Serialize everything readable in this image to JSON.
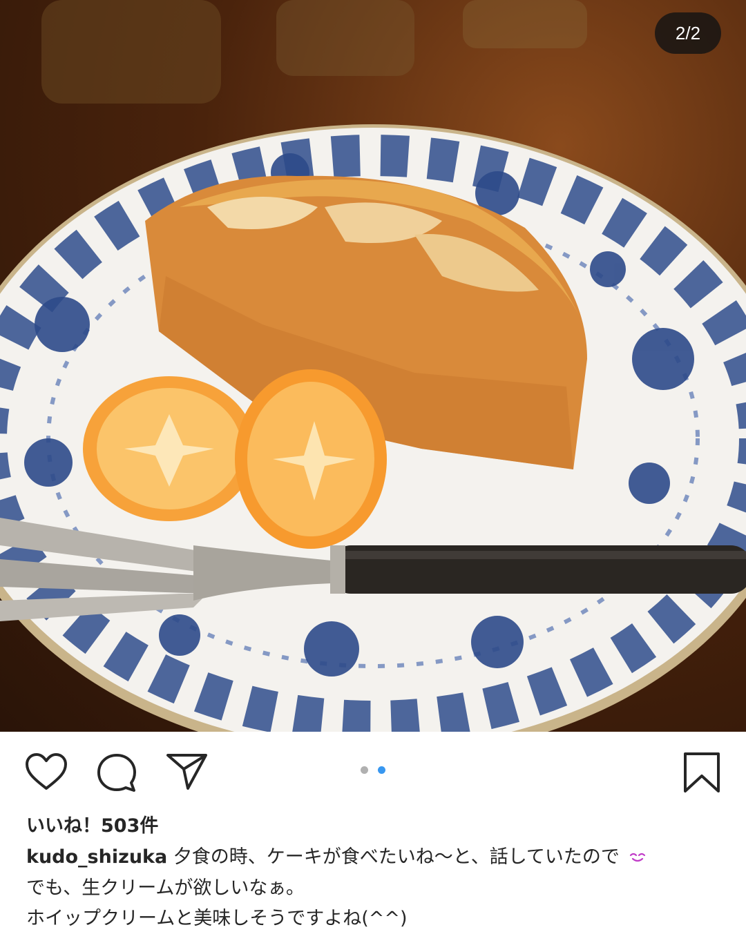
{
  "post": {
    "image_counter": "2/2",
    "image_alt": "Orange cake slice with halved kumquats and a fork on a blue-and-white patterned plate"
  },
  "carousel": {
    "active_color": "#3897f0",
    "inactive_color": "#b0b0b0"
  },
  "actions": {
    "like_icon": "heart-icon",
    "comment_icon": "comment-bubble-icon",
    "share_icon": "paper-plane-icon",
    "save_icon": "bookmark-icon"
  },
  "likes": {
    "text": "いいね！503件"
  },
  "caption": {
    "username": "kudo_shizuka",
    "line1": "夕食の時、ケーキが食べたいね〜と、話していたので",
    "emoji": "smiling-face-icon",
    "line2": "でも、生クリームが欲しいなぁ。",
    "line3": "ホイップクリームと美味しそうですよね(^^)"
  }
}
